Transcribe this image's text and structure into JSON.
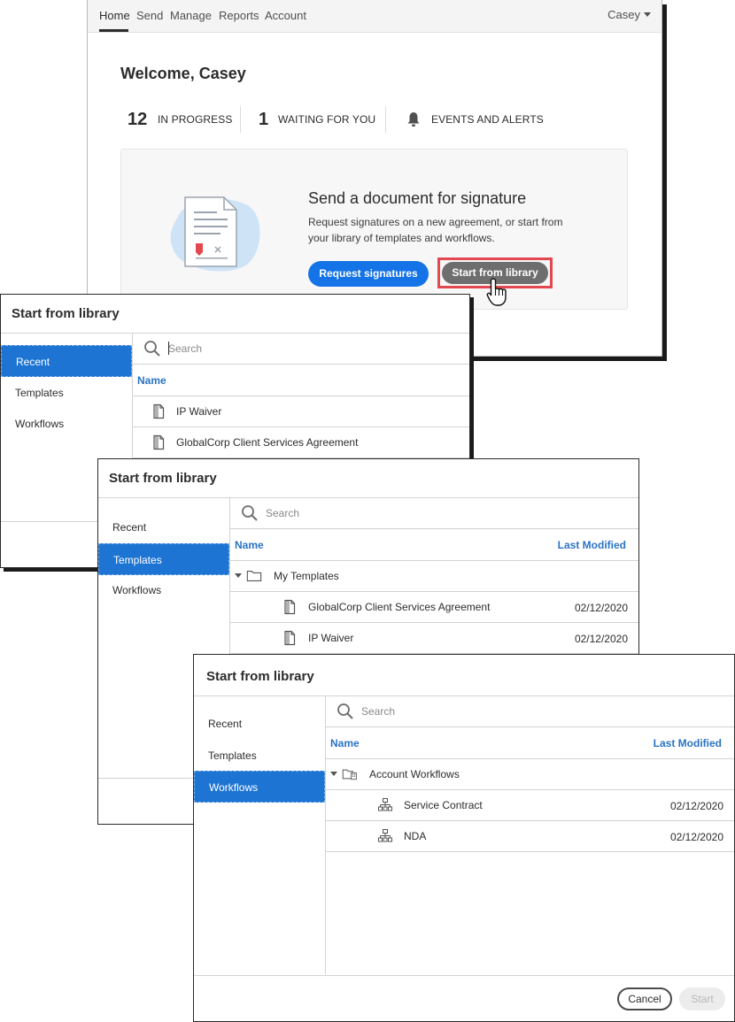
{
  "nav": {
    "items": [
      "Home",
      "Send",
      "Manage",
      "Reports",
      "Account"
    ],
    "active": "Home",
    "user": "Casey"
  },
  "home": {
    "welcome": "Welcome, Casey",
    "stats": [
      {
        "count": "12",
        "label": "IN PROGRESS"
      },
      {
        "count": "1",
        "label": "WAITING FOR YOU"
      },
      {
        "count": "",
        "label": "EVENTS AND ALERTS",
        "icon": "bell-icon"
      }
    ],
    "card": {
      "title": "Send a document for signature",
      "description": "Request signatures on a new agreement, or start from your library of templates and workflows.",
      "primary_button": "Request signatures",
      "secondary_button": "Start from library"
    }
  },
  "dialog_recent": {
    "title": "Start from library",
    "sidebar": [
      "Recent",
      "Templates",
      "Workflows"
    ],
    "active": "Recent",
    "search_placeholder": "Search",
    "col_name": "Name",
    "rows": [
      "IP Waiver",
      "GlobalCorp Client Services Agreement"
    ]
  },
  "dialog_templates": {
    "title": "Start from library",
    "sidebar": [
      "Recent",
      "Templates",
      "Workflows"
    ],
    "active": "Templates",
    "search_placeholder": "Search",
    "col_name": "Name",
    "col_modified": "Last Modified",
    "folder": "My Templates",
    "rows": [
      {
        "name": "GlobalCorp Client Services Agreement",
        "date": "02/12/2020"
      },
      {
        "name": "IP Waiver",
        "date": "02/12/2020"
      }
    ]
  },
  "dialog_workflows": {
    "title": "Start from library",
    "sidebar": [
      "Recent",
      "Templates",
      "Workflows"
    ],
    "active": "Workflows",
    "search_placeholder": "Search",
    "col_name": "Name",
    "col_modified": "Last Modified",
    "folder": "Account Workflows",
    "rows": [
      {
        "name": "Service Contract",
        "date": "02/12/2020"
      },
      {
        "name": "NDA",
        "date": "02/12/2020"
      }
    ],
    "cancel_button": "Cancel",
    "start_button": "Start"
  },
  "colors": {
    "primary_blue": "#1473e6",
    "sidebar_active": "#1e74d3",
    "column_header": "#2b73c5",
    "highlight_red": "#e34850"
  }
}
